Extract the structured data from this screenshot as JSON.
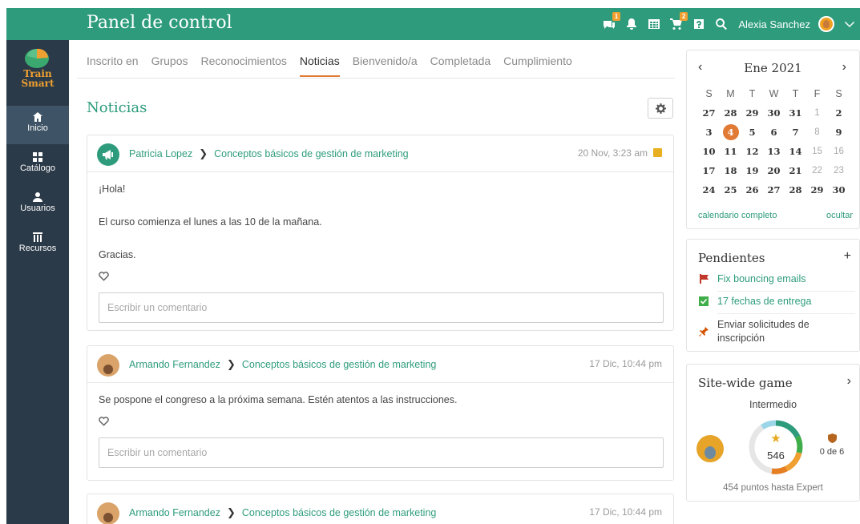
{
  "header": {
    "title": "Panel de control",
    "notifications_badge": "1",
    "cart_badge": "2",
    "user_name": "Alexia Sanchez"
  },
  "sidebar": {
    "logo_line1": "Train",
    "logo_line2": "Smart",
    "items": [
      {
        "label": "Inicio",
        "icon": "home-icon"
      },
      {
        "label": "Catálogo",
        "icon": "grid-icon"
      },
      {
        "label": "Usuarios",
        "icon": "user-icon"
      },
      {
        "label": "Recursos",
        "icon": "library-icon"
      }
    ]
  },
  "tabs": [
    {
      "label": "Inscrito en"
    },
    {
      "label": "Grupos"
    },
    {
      "label": "Reconocimientos"
    },
    {
      "label": "Noticias",
      "active": true
    },
    {
      "label": "Bienvenido/a"
    },
    {
      "label": "Completada"
    },
    {
      "label": "Cumplimiento"
    }
  ],
  "main": {
    "title": "Noticias",
    "comment_placeholder": "Escribir un comentario",
    "posts": [
      {
        "author": "Patricia Lopez",
        "course": "Conceptos básicos de gestión de marketing",
        "date": "20 Nov, 3:23 am",
        "lines": [
          "¡Hola!",
          "El curso comienza el lunes a las 10 de la mañana.",
          "Gracias."
        ]
      },
      {
        "author": "Armando Fernandez",
        "course": "Conceptos básicos de gestión de marketing",
        "date": "17 Dic, 10:44 pm",
        "lines": [
          "Se pospone el congreso a la próxima semana. Estén atentos a las instrucciones."
        ]
      },
      {
        "author": "Armando Fernandez",
        "course": "Conceptos básicos de gestión de marketing",
        "date": "17 Dic, 10:44 pm",
        "lines": []
      }
    ]
  },
  "calendar": {
    "month": "Ene 2021",
    "weekdays": [
      "S",
      "M",
      "T",
      "W",
      "T",
      "F",
      "S"
    ],
    "weeks": [
      [
        "27",
        "28",
        "29",
        "30",
        "31",
        "1",
        "2"
      ],
      [
        "3",
        "4",
        "5",
        "6",
        "7",
        "8",
        "9"
      ],
      [
        "10",
        "11",
        "12",
        "13",
        "14",
        "15",
        "16"
      ],
      [
        "17",
        "18",
        "19",
        "20",
        "21",
        "22",
        "23"
      ],
      [
        "24",
        "25",
        "26",
        "27",
        "28",
        "29",
        "30"
      ]
    ],
    "today": "4",
    "full_calendar_link": "calendario completo",
    "hide_link": "ocultar"
  },
  "pending": {
    "title": "Pendientes",
    "add": "+",
    "items": [
      {
        "label": "Fix bouncing emails",
        "icon": "flag-icon"
      },
      {
        "label": "17 fechas de entrega",
        "icon": "checkbox-icon"
      },
      {
        "label": "Enviar solicitudes de inscripción",
        "icon": "pin-icon"
      }
    ]
  },
  "game": {
    "title": "Site-wide game",
    "level": "Intermedio",
    "points": "546",
    "badges": "0 de 6",
    "to_next": "454 puntos hasta Expert"
  },
  "colors": {
    "brand_green": "#2e9c7c",
    "sidebar": "#2b3a48",
    "accent_orange": "#e07a35"
  }
}
